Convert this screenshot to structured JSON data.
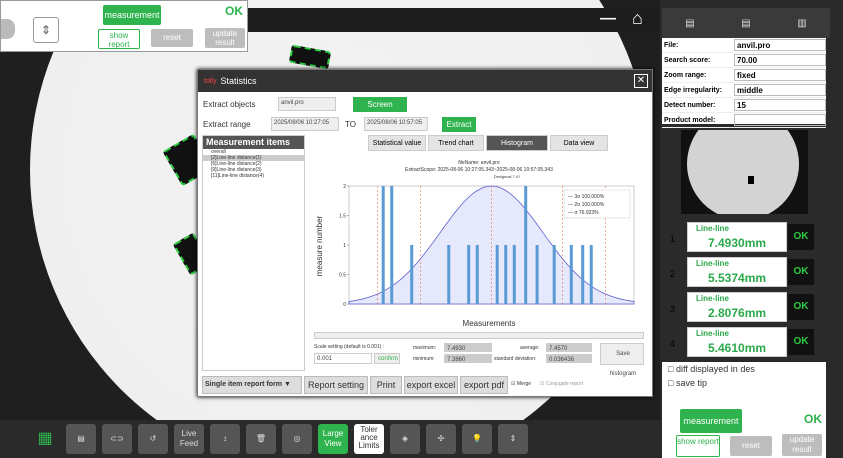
{
  "top_left": {
    "measurement": "measurement",
    "ok": "OK",
    "show_report": "show report",
    "reset": "reset",
    "update_result": "update result"
  },
  "params": [
    {
      "label": "File:",
      "value": "anvil.pro"
    },
    {
      "label": "Search score:",
      "value": "70.00"
    },
    {
      "label": "Zoom range:",
      "value": "fixed"
    },
    {
      "label": "Edge irregularity:",
      "value": "middle"
    },
    {
      "label": "Detect number:",
      "value": "15"
    },
    {
      "label": "Product model:",
      "value": ""
    }
  ],
  "right_tools": [
    "Excel",
    "Excel",
    "chart"
  ],
  "measurements": [
    {
      "n": "1",
      "title": "Line-line",
      "value": "7.4930mm",
      "status": "OK"
    },
    {
      "n": "2",
      "title": "Line-line",
      "value": "5.5374mm",
      "status": "OK"
    },
    {
      "n": "3",
      "title": "Line-line",
      "value": "2.8076mm",
      "status": "OK"
    },
    {
      "n": "4",
      "title": "Line-line",
      "value": "5.4610mm",
      "status": "OK"
    }
  ],
  "right_bottom": {
    "diff": "diff displayed in des",
    "save_tip": "save tip",
    "measurement": "measurement",
    "ok": "OK",
    "show_report": "show report",
    "reset": "reset",
    "update_result": "update result"
  },
  "bottom": {
    "live_feed": "Live Feed",
    "large_view": "Large View",
    "tolerance": "Toler ance Limits"
  },
  "dialog": {
    "title": "Statistics",
    "extract_objects_label": "Extract objects",
    "extract_objects_value": "anvil.pro",
    "screen": "Screen",
    "extract_range_label": "Extract range",
    "from": "2025/08/06 10:27:05",
    "to_label": "TO",
    "to": "2025/08/06 10:57:05",
    "extract": "Extract",
    "items_header": "Measurement items",
    "items": [
      "overall",
      "[2]Line-line distance(1)",
      "[6]Line-line distance(2)",
      "[9]Line-line distance(3)",
      "[11]Line-line distance(4)"
    ],
    "tabs": [
      "Statistical value",
      "Trend chart",
      "Histogram",
      "Data view"
    ],
    "scale_label": "Scale setting (default is 0.001) :",
    "scale_value": "0.001",
    "confirm": "confirm",
    "max_label": "maximum:",
    "max": "7.4930",
    "avg_label": "average:",
    "avg": "7.4570",
    "min_label": "minimum:",
    "min": "7.3860",
    "std_label": "standard deviation:",
    "std": "0.036436",
    "save_hist": "Save histogram",
    "report_form": "Single item report form",
    "report_setting": "Report setting",
    "print": "Print",
    "export_excel": "export excel",
    "export_pdf": "export pdf",
    "merge": "Merge",
    "conjugate": "Conjugate report"
  },
  "chart_data": {
    "type": "bar",
    "title": "fileName: anvil.pro",
    "subtitle": "ExtractScope: 2025-08-06 10:27:05.343~2025-08-06 10:57:05.343",
    "annotation": "Designval 7.4?",
    "xlabel": "Measurements",
    "ylabel": "measure number",
    "ylim": [
      0,
      2
    ],
    "yticks": [
      0,
      0.5,
      1,
      1.5,
      2
    ],
    "bars": [
      {
        "x": 0.12,
        "y": 2
      },
      {
        "x": 0.15,
        "y": 2
      },
      {
        "x": 0.22,
        "y": 1
      },
      {
        "x": 0.35,
        "y": 1
      },
      {
        "x": 0.42,
        "y": 1
      },
      {
        "x": 0.45,
        "y": 1
      },
      {
        "x": 0.52,
        "y": 1
      },
      {
        "x": 0.55,
        "y": 1
      },
      {
        "x": 0.58,
        "y": 1
      },
      {
        "x": 0.62,
        "y": 2
      },
      {
        "x": 0.66,
        "y": 1
      },
      {
        "x": 0.72,
        "y": 1
      },
      {
        "x": 0.78,
        "y": 1
      },
      {
        "x": 0.82,
        "y": 1
      },
      {
        "x": 0.85,
        "y": 1
      }
    ],
    "legend": [
      {
        "name": "3σ",
        "value": "100.000%"
      },
      {
        "name": "2σ",
        "value": "100.000%"
      },
      {
        "name": "σ",
        "value": "76.923%"
      }
    ],
    "colors": {
      "bar": "#5b9bd5",
      "curve": "#5a5fd0",
      "fill": "#e6e8fb",
      "sigma": "#e05a2a"
    }
  }
}
